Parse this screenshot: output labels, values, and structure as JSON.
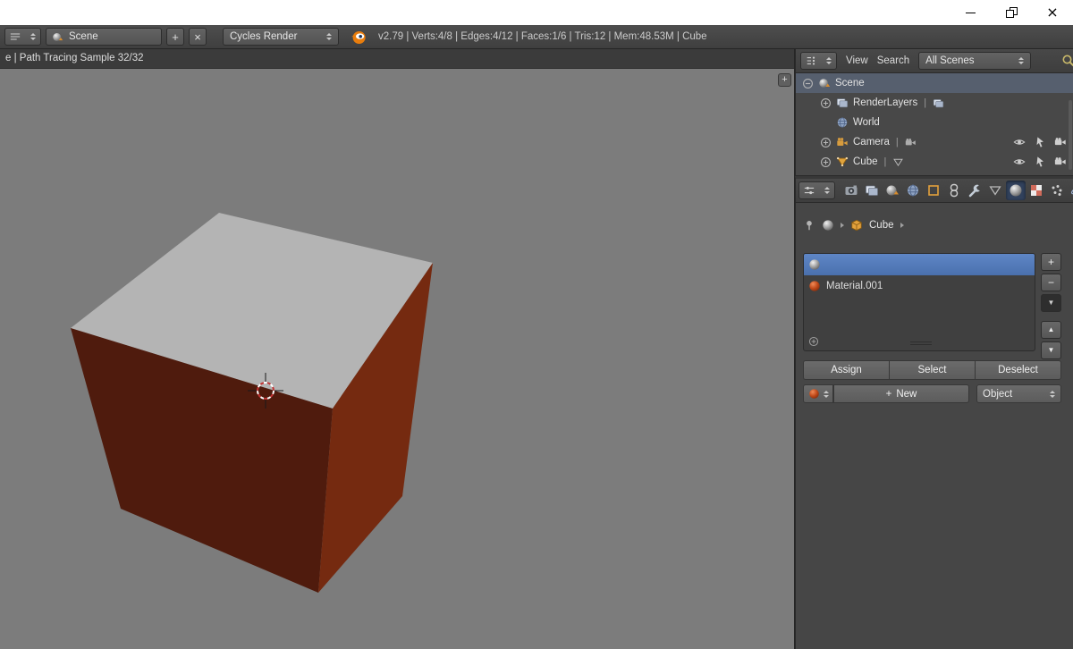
{
  "window": {
    "controls": [
      "minimize",
      "restore-down",
      "close"
    ],
    "close_glyph": "×"
  },
  "glyphs": {
    "plus": "+",
    "minus": "−",
    "x": "×",
    "pipe": "|",
    "up_arrow": "▲",
    "down_arrow": "▼"
  },
  "topbar": {
    "scene_name": "Scene",
    "engine": "Cycles Render",
    "stats": "v2.79 | Verts:4/8 | Edges:4/12 | Faces:1/6 | Tris:12 | Mem:48.53M | Cube"
  },
  "viewport": {
    "render_status": "e | Path Tracing Sample 32/32",
    "colors": {
      "background": "#7c7c7c",
      "cube_top": "#b4b4b4",
      "cube_left": "#4f1b0d",
      "cube_right": "#752a10"
    }
  },
  "outliner": {
    "menus": {
      "view": "View",
      "search": "Search"
    },
    "scope": "All Scenes",
    "rows": [
      {
        "label": "Scene"
      },
      {
        "label": "RenderLayers"
      },
      {
        "label": "World"
      },
      {
        "label": "Camera"
      },
      {
        "label": "Cube"
      }
    ]
  },
  "properties": {
    "tabs": [
      "render",
      "render-layers",
      "scene",
      "world",
      "object",
      "constraints",
      "modifiers",
      "object-data",
      "material",
      "texture",
      "particles",
      "physics"
    ],
    "active_tab": "material",
    "context_object": "Cube",
    "material_slots": [
      {
        "name": "",
        "selected": true
      },
      {
        "name": "Material.001",
        "selected": false
      }
    ],
    "buttons": {
      "assign": "Assign",
      "select": "Select",
      "deselect": "Deselect",
      "new": "New"
    },
    "link_mode": "Object"
  },
  "colors": {
    "selection_blue": "#4a70ad",
    "material_preview_red": "#c14a1a",
    "header_bg": "#454545",
    "panel_bg": "#464646"
  }
}
